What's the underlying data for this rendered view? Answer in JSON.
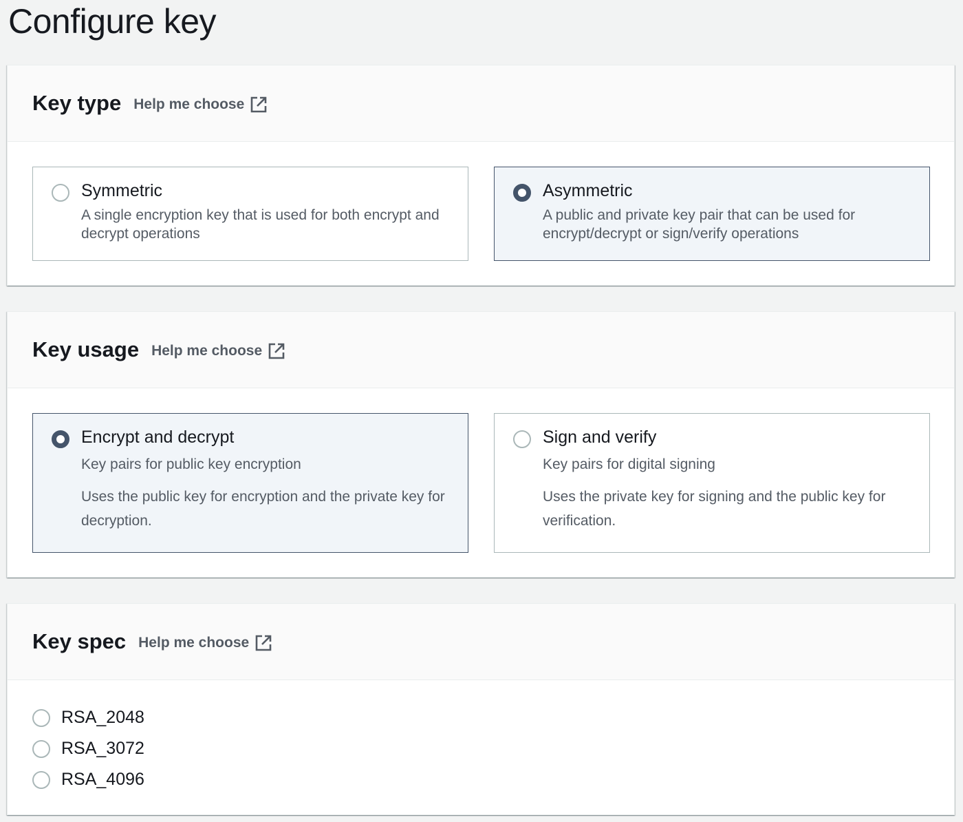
{
  "page": {
    "title": "Configure key"
  },
  "key_type": {
    "title": "Key type",
    "help_label": "Help me choose",
    "options": [
      {
        "title": "Symmetric",
        "description": "A single encryption key that is used for both encrypt and decrypt operations",
        "selected": false
      },
      {
        "title": "Asymmetric",
        "description": "A public and private key pair that can be used for encrypt/decrypt or sign/verify operations",
        "selected": true
      }
    ]
  },
  "key_usage": {
    "title": "Key usage",
    "help_label": "Help me choose",
    "options": [
      {
        "title": "Encrypt and decrypt",
        "subtitle": "Key pairs for public key encryption",
        "text": "Uses the public key for encryption and the private key for decryption.",
        "selected": true
      },
      {
        "title": "Sign and verify",
        "subtitle": "Key pairs for digital signing",
        "text": "Uses the private key for signing and the public key for verification.",
        "selected": false
      }
    ]
  },
  "key_spec": {
    "title": "Key spec",
    "help_label": "Help me choose",
    "options": [
      {
        "label": "RSA_2048",
        "selected": false
      },
      {
        "label": "RSA_3072",
        "selected": false
      },
      {
        "label": "RSA_4096",
        "selected": false
      }
    ]
  },
  "colors": {
    "background": "#f2f3f3",
    "selected_tile_bg": "#f1f5f9",
    "selected_border": "#44546a",
    "muted_text": "#545b64",
    "unselected_border": "#aab7b8"
  },
  "icons": {
    "help_link": "external-link-icon"
  }
}
